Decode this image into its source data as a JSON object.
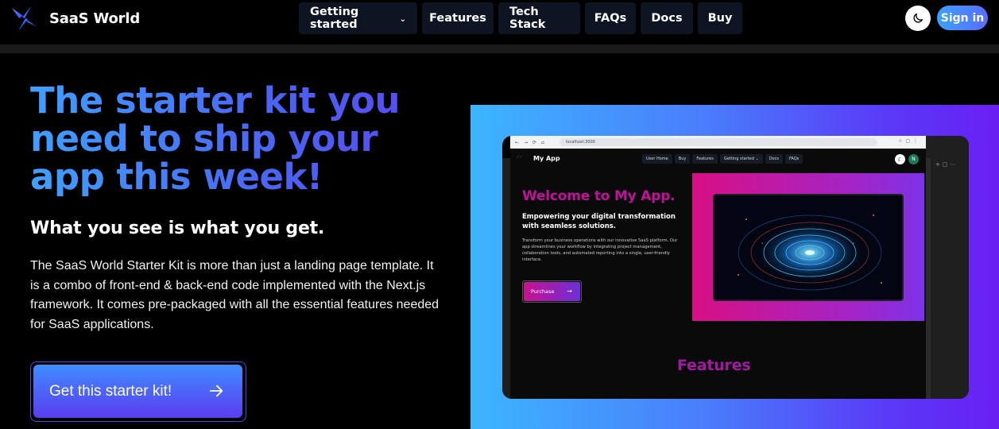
{
  "brand": {
    "name": "SaaS World"
  },
  "nav": {
    "items": [
      {
        "label": "Getting started",
        "has_dropdown": true
      },
      {
        "label": "Features"
      },
      {
        "label": "Tech Stack"
      },
      {
        "label": "FAQs"
      },
      {
        "label": "Docs"
      },
      {
        "label": "Buy"
      }
    ],
    "signin_label": "Sign in",
    "theme_icon": "moon-icon"
  },
  "hero": {
    "title": "The starter kit you need to ship your app this week!",
    "subtitle": "What you see is what you get.",
    "description": "The SaaS World Starter Kit is more than just a landing page template. It is a combo of front-end & back-end code implemented with the Next.js framework. It comes pre-packaged with all the essential features needed for SaaS applications.",
    "cta_label": "Get this starter kit!"
  },
  "preview": {
    "url": "localhost:3000",
    "app_name": "My App",
    "menu": [
      "User Home",
      "Buy",
      "Features",
      "Getting started ⌄",
      "Docs",
      "FAQs"
    ],
    "avatar_initial": "N",
    "welcome": "Welcome to My App.",
    "tagline": "Empowering your digital transformation with seamless solutions.",
    "body": "Transform your business operations with our innovative SaaS platform. Our app streamlines your workflow by integrating project management, collaboration tools, and automated reporting into a single, user-friendly interface.",
    "purchase_label": "Purchase",
    "features_heading": "Features"
  },
  "colors": {
    "accent_blue": "#3fa0ff",
    "accent_purple": "#5a3cf0",
    "nav_bg": "#0e1422"
  }
}
